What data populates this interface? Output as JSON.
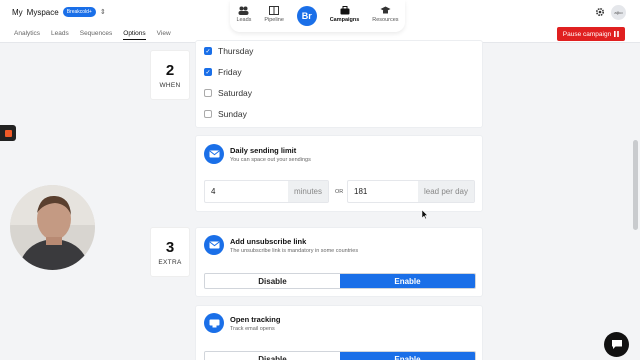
{
  "workspace": {
    "owner": "My",
    "name": "Myspace",
    "badge": "Breakcold+"
  },
  "topnav": {
    "leads": "Leads",
    "pipeline": "Pipeline",
    "logo": "Br",
    "campaigns": "Campaigns",
    "resources": "Resources"
  },
  "user_avatar": "aljko",
  "tabs": [
    "Analytics",
    "Leads",
    "Sequences",
    "Options",
    "View"
  ],
  "active_tab": "Options",
  "pause_button": "Pause campaign",
  "steps": [
    {
      "number": "2",
      "label": "WHEN"
    },
    {
      "number": "3",
      "label": "EXTRA"
    }
  ],
  "days": [
    {
      "label": "Thursday",
      "checked": true
    },
    {
      "label": "Friday",
      "checked": true
    },
    {
      "label": "Saturday",
      "checked": false
    },
    {
      "label": "Sunday",
      "checked": false
    }
  ],
  "daily_limit": {
    "title": "Daily sending limit",
    "subtitle": "You can space out your sendings",
    "minutes_value": "4",
    "minutes_suffix": "minutes",
    "or_label": "OR",
    "leads_value": "181",
    "leads_suffix": "lead per day"
  },
  "unsubscribe": {
    "title": "Add unsubscribe link",
    "subtitle": "The unsubscribe link is mandatory in some countries",
    "disable": "Disable",
    "enable": "Enable",
    "selected": "Enable"
  },
  "tracking": {
    "title": "Open tracking",
    "subtitle": "Track email opens",
    "disable": "Disable",
    "enable": "Enable",
    "selected": "Enable"
  },
  "colors": {
    "accent": "#1a6fe8",
    "danger": "#e02020"
  }
}
